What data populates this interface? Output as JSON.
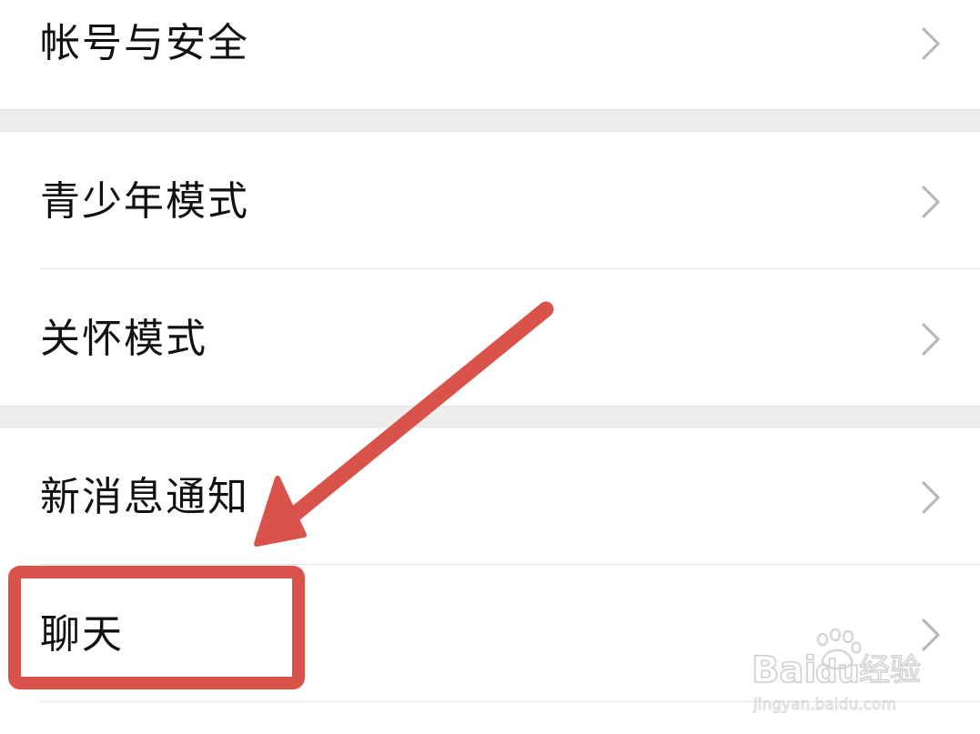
{
  "settings": {
    "items": [
      {
        "id": "account-security",
        "label": "帐号与安全"
      },
      {
        "id": "youth-mode",
        "label": "青少年模式"
      },
      {
        "id": "care-mode",
        "label": "关怀模式"
      },
      {
        "id": "new-message-notification",
        "label": "新消息通知"
      },
      {
        "id": "chat",
        "label": "聊天"
      }
    ]
  },
  "annotation": {
    "color": "#d9534a",
    "highlighted_item": "聊天"
  },
  "watermark": {
    "brand_text": "Bai",
    "brand_text_2": "du",
    "brand_cn": "经验",
    "url": "jingyan.baidu.com"
  }
}
